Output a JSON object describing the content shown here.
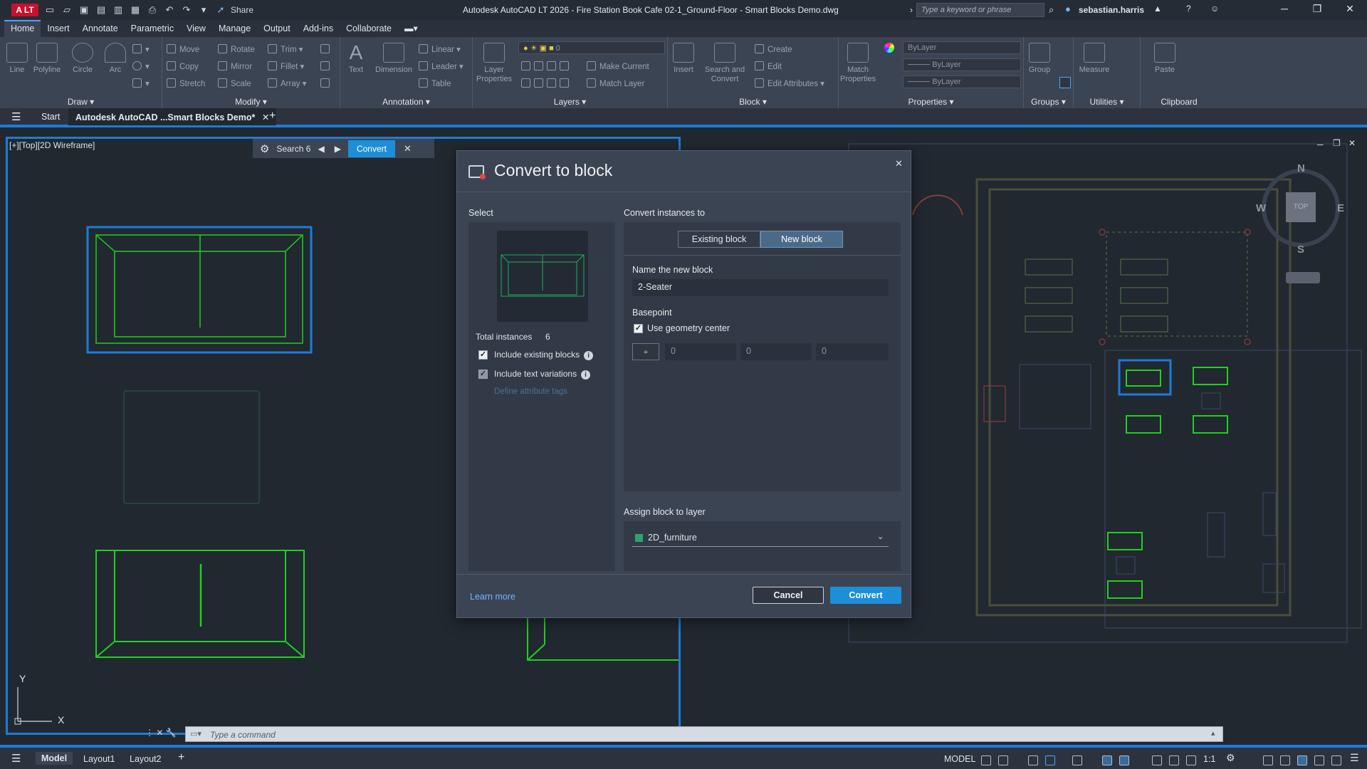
{
  "titlebar": {
    "logo": "A LT",
    "share": "Share",
    "title": "Autodesk AutoCAD LT 2026 - Fire Station Book Cafe 02-1_Ground-Floor - Smart Blocks Demo.dwg",
    "search_placeholder": "Type a keyword or phrase",
    "user": "sebastian.harris"
  },
  "menu": [
    "Home",
    "Insert",
    "Annotate",
    "Parametric",
    "View",
    "Manage",
    "Output",
    "Add-ins",
    "Collaborate"
  ],
  "ribbon": {
    "draw": {
      "title": "Draw",
      "line": "Line",
      "polyline": "Polyline",
      "circle": "Circle",
      "arc": "Arc"
    },
    "modify": {
      "title": "Modify",
      "move": "Move",
      "rotate": "Rotate",
      "trim": "Trim",
      "copy": "Copy",
      "mirror": "Mirror",
      "fillet": "Fillet",
      "stretch": "Stretch",
      "scale": "Scale",
      "array": "Array"
    },
    "annotation": {
      "title": "Annotation",
      "text": "Text",
      "dimension": "Dimension",
      "linear": "Linear",
      "leader": "Leader",
      "table": "Table"
    },
    "layers": {
      "title": "Layers",
      "layer_properties": "Layer Properties",
      "current_layer": "0",
      "make_current": "Make Current",
      "match_layer": "Match Layer"
    },
    "block": {
      "title": "Block",
      "insert": "Insert",
      "search_and_convert": "Search and Convert",
      "create": "Create",
      "edit": "Edit",
      "edit_attributes": "Edit Attributes"
    },
    "properties": {
      "title": "Properties",
      "match_properties": "Match Properties",
      "color": "ByLayer",
      "linetype": "ByLayer",
      "lineweight": "ByLayer"
    },
    "groups": {
      "title": "Groups",
      "group": "Group"
    },
    "utilities": {
      "title": "Utilities",
      "measure": "Measure"
    },
    "clipboard": {
      "title": "Clipboard",
      "paste": "Paste"
    }
  },
  "doctabs": {
    "start": "Start",
    "active": "Autodesk AutoCAD ...Smart Blocks Demo*"
  },
  "viewport": {
    "label": "[+][Top][2D Wireframe]"
  },
  "convert_bar": {
    "search_label": "Search 6",
    "convert_button": "Convert"
  },
  "viewcube": {
    "n": "N",
    "s": "S",
    "e": "E",
    "w": "W",
    "top": "TOP"
  },
  "dialog": {
    "title": "Convert to block",
    "select_label": "Select",
    "total_instances_label": "Total instances",
    "total_instances_value": "6",
    "include_existing_blocks": "Include existing blocks",
    "include_text_variations": "Include text variations",
    "define_attribute_tags": "Define attribute tags",
    "convert_instances_to": "Convert instances to",
    "existing_block": "Existing block",
    "new_block": "New block",
    "name_label": "Name the new block",
    "name_value": "2-Seater",
    "basepoint_label": "Basepoint",
    "use_geometry_center": "Use geometry center",
    "base_x": "0",
    "base_y": "0",
    "base_z": "0",
    "assign_layer_label": "Assign block to layer",
    "layer_value": "2D_furniture",
    "learn_more": "Learn more",
    "cancel": "Cancel",
    "convert": "Convert"
  },
  "cmdline": {
    "placeholder": "Type a command"
  },
  "statusbar": {
    "model": "Model",
    "layout1": "Layout1",
    "layout2": "Layout2",
    "model_btn": "MODEL",
    "scale": "1:1"
  },
  "ucs": {
    "y": "Y",
    "x": "X"
  },
  "colors": {
    "accent": "#1d7bd8",
    "green": "#1fd01f",
    "layer_swatch": "#2fa36b"
  }
}
